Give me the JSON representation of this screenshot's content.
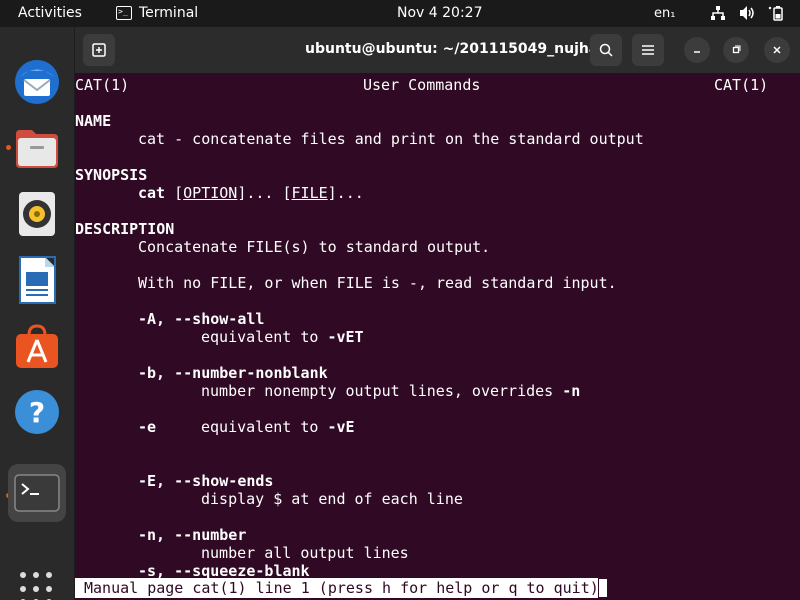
{
  "topbar": {
    "activities": "Activities",
    "app_name": "Terminal",
    "clock": "Nov 4  20:27",
    "lang": "en₁"
  },
  "window": {
    "title": "ubuntu@ubuntu: ~/201115049_nujhat"
  },
  "manpage": {
    "header_left": "CAT(1)",
    "header_center": "User Commands",
    "header_right": "CAT(1)",
    "name_heading": "NAME",
    "name_text": "cat - concatenate files and print on the standard output",
    "synopsis_heading": "SYNOPSIS",
    "synopsis_cmd": "cat",
    "synopsis_opt": "OPTION",
    "synopsis_file": "FILE",
    "description_heading": "DESCRIPTION",
    "desc_1": "Concatenate FILE(s) to standard output.",
    "desc_2": "With no FILE, or when FILE is -, read standard input.",
    "opt_A": "-A, --show-all",
    "opt_A_desc": "equivalent to ",
    "opt_A_flag": "-vET",
    "opt_b": "-b, --number-nonblank",
    "opt_b_desc": "number nonempty output lines, overrides ",
    "opt_b_flag": "-n",
    "opt_e": "-e",
    "opt_e_desc": "equivalent to ",
    "opt_e_flag": "-vE",
    "opt_E": "-E, --show-ends",
    "opt_E_desc": "display $ at end of each line",
    "opt_n": "-n, --number",
    "opt_n_desc": "number all output lines",
    "opt_s": "-s, --squeeze-blank"
  },
  "status": {
    "text": "Manual page cat(1) line 1 (press h for help or q to quit)"
  },
  "colors": {
    "terminal_bg": "#300a24",
    "accent": "#e95420"
  }
}
